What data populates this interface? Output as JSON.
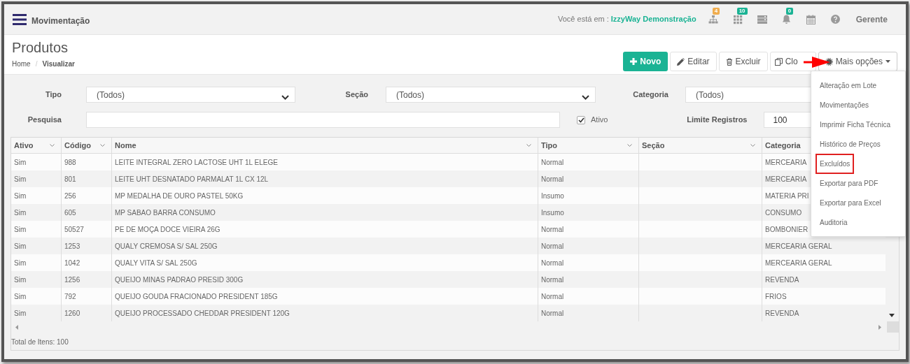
{
  "topbar": {
    "title": "Movimentação",
    "location_label": "Você está em :",
    "location_value": "IzzyWay Demonstração",
    "icons": [
      {
        "kind": "sitemap",
        "badge": "4",
        "color": "#f0ad4e"
      },
      {
        "kind": "grid",
        "badge": "10",
        "color": "#1ab394"
      },
      {
        "kind": "server"
      },
      {
        "kind": "bell",
        "badge": "0",
        "color": "#1ab394"
      },
      {
        "kind": "calendar"
      },
      {
        "kind": "help"
      }
    ],
    "user": "Gerente"
  },
  "page": {
    "title": "Produtos",
    "breadcrumb": [
      "Home",
      "Visualizar"
    ],
    "breadcrumb_separator": "/"
  },
  "toolbar": {
    "buttons": [
      {
        "kind": "new",
        "label": "Novo"
      },
      {
        "kind": "edit",
        "label": "Editar"
      },
      {
        "kind": "delete",
        "label": "Excluir"
      },
      {
        "kind": "clone",
        "label": "Clo"
      },
      {
        "kind": "more",
        "label": "Mais opções"
      }
    ]
  },
  "menu": {
    "items": [
      {
        "label": "Alteração em Lote",
        "highlighted": false
      },
      {
        "label": "Movimentações",
        "highlighted": false
      },
      {
        "label": "Imprimir Ficha Técnica",
        "highlighted": false
      },
      {
        "label": "Histórico de Preços",
        "highlighted": false
      },
      {
        "label": "Excluídos",
        "highlighted": true
      },
      {
        "label": "Exportar para PDF",
        "highlighted": false
      },
      {
        "label": "Exportar para Excel",
        "highlighted": false
      },
      {
        "label": "Auditoria",
        "highlighted": false
      }
    ]
  },
  "filters": {
    "tipo": {
      "label": "Tipo",
      "value": "(Todos)"
    },
    "secao": {
      "label": "Seção",
      "value": "(Todos)"
    },
    "categoria": {
      "label": "Categoria",
      "value": "(Todos)"
    },
    "pesquisa": {
      "label": "Pesquisa"
    },
    "ativo": {
      "label": "Ativo",
      "checked": true
    },
    "limite": {
      "label": "Limite Registros",
      "value": "100"
    }
  },
  "table": {
    "columns": [
      {
        "label": "Ativo",
        "sortable": true
      },
      {
        "label": "Código",
        "sortable": true
      },
      {
        "label": "Nome",
        "sortable": true
      },
      {
        "label": "Tipo",
        "sortable": true
      },
      {
        "label": "Seção",
        "sortable": true
      },
      {
        "label": "Categoria"
      }
    ],
    "rows": [
      [
        "Sim",
        "988",
        "LEITE INTEGRAL ZERO LACTOSE UHT 1L ELEGE",
        "Normal",
        "",
        "MERCEARIA"
      ],
      [
        "Sim",
        "801",
        "LEITE UHT DESNATADO PARMALAT 1L CX 12L",
        "Normal",
        "",
        "MERCEARIA"
      ],
      [
        "Sim",
        "256",
        "MP MEDALHA DE OURO PASTEL 50KG",
        "Insumo",
        "",
        "MATERIA PRI"
      ],
      [
        "Sim",
        "605",
        "MP SABAO BARRA CONSUMO",
        "Insumo",
        "",
        "CONSUMO"
      ],
      [
        "Sim",
        "50527",
        "PE DE MOÇA DOCE VIEIRA 26G",
        "Normal",
        "",
        "BOMBONIER"
      ],
      [
        "Sim",
        "1253",
        "QUALY CREMOSA S/ SAL 250G",
        "Normal",
        "",
        "MERCEARIA GERAL"
      ],
      [
        "Sim",
        "1042",
        "QUALY VITA S/ SAL 250G",
        "Normal",
        "",
        "MERCEARIA GERAL"
      ],
      [
        "Sim",
        "1256",
        "QUEIJO MINAS PADRAO PRESID 300G",
        "Normal",
        "",
        "REVENDA"
      ],
      [
        "Sim",
        "792",
        "QUEIJO GOUDA FRACIONADO PRESIDENT 185G",
        "Normal",
        "",
        "FRIOS"
      ],
      [
        "Sim",
        "1260",
        "QUEIJO PROCESSADO CHEDDAR PRESIDENT 120G",
        "Normal",
        "",
        "REVENDA"
      ]
    ],
    "footer": "Total de Itens: 100"
  }
}
